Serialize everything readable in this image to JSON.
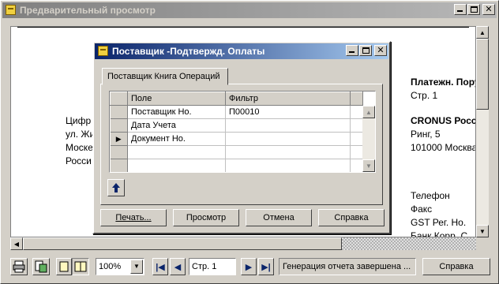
{
  "main_window": {
    "title": "Предварительный просмотр",
    "report_lines_left": [
      "Цифр",
      "ул. Жи",
      "Моске",
      "Росси"
    ],
    "report_header_right": "Платежн. Пору",
    "page_line": "Стр. 1",
    "company_name": "CRONUS Росси",
    "company_address": [
      "Ринг, 5",
      "101000 Москва"
    ],
    "contact_labels": [
      "Телефон",
      "Факс",
      "GST Рег. Но.",
      "Банк Корр. С"
    ]
  },
  "dialog": {
    "title": "Поставщик -Подтвержд. Оплаты",
    "tab_label": "Поставщик Книга Операций",
    "grid": {
      "headers": [
        "Поле",
        "Фильтр"
      ],
      "rows": [
        {
          "field": "Поставщик Но.",
          "filter": "П00010"
        },
        {
          "field": "Дата Учета",
          "filter": ""
        },
        {
          "field": "Документ Но.",
          "filter": ""
        },
        {
          "field": "",
          "filter": ""
        },
        {
          "field": "",
          "filter": ""
        }
      ],
      "current_row_marker": "▶"
    },
    "buttons": {
      "print": "Печать...",
      "preview": "Просмотр",
      "cancel": "Отмена",
      "help": "Справка"
    }
  },
  "toolbar": {
    "zoom_value": "100%",
    "page_value": "Стр. 1",
    "status_text": "Генерация отчета завершена ...",
    "help_label": "Справка"
  },
  "colors": {
    "active_title": "#0a246a",
    "inactive_title": "#808080",
    "face": "#d4d0c8"
  }
}
